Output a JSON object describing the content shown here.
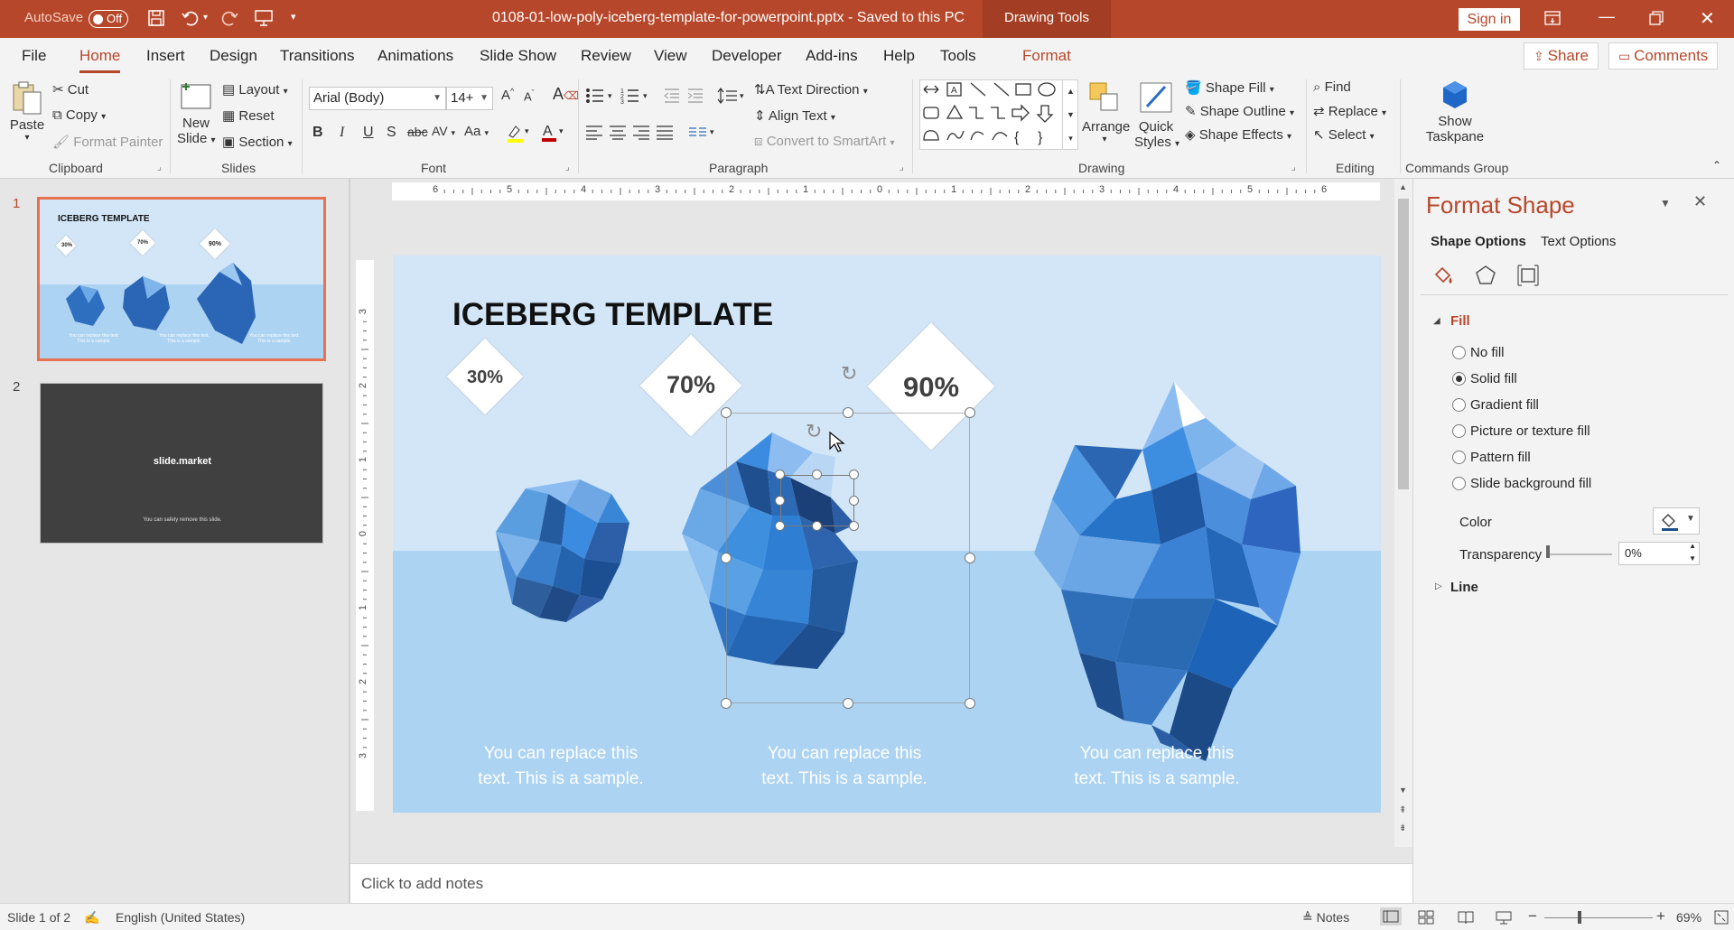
{
  "titlebar": {
    "autosave_label": "AutoSave",
    "autosave_state": "Off",
    "file_title": "0108-01-low-poly-iceberg-template-for-powerpoint.pptx  -  Saved to this PC",
    "contextual_tab": "Drawing Tools",
    "sign_in": "Sign in"
  },
  "menu": {
    "tabs": [
      "File",
      "Home",
      "Insert",
      "Design",
      "Transitions",
      "Animations",
      "Slide Show",
      "Review",
      "View",
      "Developer",
      "Add-ins",
      "Help",
      "Tools",
      "Format"
    ],
    "share": "Share",
    "comments": "Comments"
  },
  "ribbon": {
    "clipboard": {
      "paste": "Paste",
      "cut": "Cut",
      "copy": "Copy",
      "format_painter": "Format Painter",
      "label": "Clipboard"
    },
    "slides": {
      "new_slide_1": "New",
      "new_slide_2": "Slide",
      "layout": "Layout",
      "reset": "Reset",
      "section": "Section",
      "label": "Slides"
    },
    "font": {
      "name": "Arial (Body)",
      "size": "14+",
      "label": "Font"
    },
    "paragraph": {
      "text_direction": "Text Direction",
      "align_text": "Align Text",
      "convert_smartart": "Convert to SmartArt",
      "label": "Paragraph"
    },
    "drawing": {
      "arrange": "Arrange",
      "quick_styles_1": "Quick",
      "quick_styles_2": "Styles",
      "shape_fill": "Shape Fill",
      "shape_outline": "Shape Outline",
      "shape_effects": "Shape Effects",
      "label": "Drawing"
    },
    "editing": {
      "find": "Find",
      "replace": "Replace",
      "select": "Select",
      "label": "Editing"
    },
    "commands": {
      "show_1": "Show",
      "show_2": "Taskpane",
      "label": "Commands Group"
    }
  },
  "thumbnails": {
    "slide1": {
      "num": "1",
      "title": "ICEBERG TEMPLATE",
      "p1": "30%",
      "p2": "70%",
      "p3": "90%",
      "caption": "You can replace this text. This is a sample."
    },
    "slide2": {
      "num": "2",
      "brand": "slide.market",
      "note": "You can safely remove this slide."
    }
  },
  "slide": {
    "title": "ICEBERG TEMPLATE",
    "items": [
      {
        "percent": "30%",
        "caption_1": "You can replace this",
        "caption_2": "text. This is a sample."
      },
      {
        "percent": "70%",
        "caption_1": "You can replace this",
        "caption_2": "text. This is a sample."
      },
      {
        "percent": "90%",
        "caption_1": "You can replace this",
        "caption_2": "text. This is a sample."
      }
    ]
  },
  "ruler_h_labels": [
    "6",
    "5",
    "4",
    "3",
    "2",
    "1",
    "0",
    "1",
    "2",
    "3",
    "4",
    "5",
    "6"
  ],
  "ruler_v_labels": [
    "3",
    "2",
    "1",
    "0",
    "1",
    "2",
    "3"
  ],
  "notes_placeholder": "Click to add notes",
  "format_pane": {
    "title": "Format Shape",
    "tab_shape": "Shape Options",
    "tab_text": "Text Options",
    "fill_header": "Fill",
    "options": [
      "No fill",
      "Solid fill",
      "Gradient fill",
      "Picture or texture fill",
      "Pattern fill",
      "Slide background fill"
    ],
    "selected": "Solid fill",
    "color_label": "Color",
    "transparency_label": "Transparency",
    "transparency_value": "0%",
    "line_header": "Line"
  },
  "status": {
    "slide_of": "Slide 1 of 2",
    "language": "English (United States)",
    "notes": "Notes",
    "zoom": "69%"
  },
  "colors": {
    "accent": "#b7472a",
    "slide_sky": "#d2e6f7",
    "slide_water": "#acd3f2"
  }
}
